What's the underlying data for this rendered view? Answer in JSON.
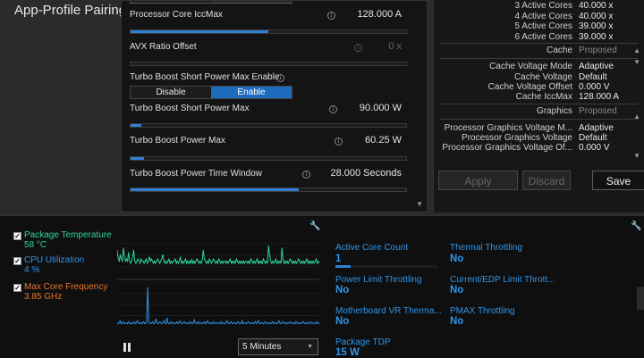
{
  "app": {
    "section_title": "App-Profile Pairing"
  },
  "tuning": {
    "partial_toggle": {
      "left": "Disable",
      "right": "Enable"
    },
    "rows": [
      {
        "label": "Processor Core IccMax",
        "value": "128.000 A",
        "level": 0.5
      },
      {
        "label": "AVX Ratio Offset",
        "value": "0 x",
        "level": 0.0
      },
      {
        "label": "Turbo Boost Short Power Max Enable",
        "toggle": {
          "left": "Disable",
          "right": "Enable",
          "selected": "Enable"
        }
      },
      {
        "label": "Turbo Boost Short Power Max",
        "value": "90.000 W",
        "level": 0.04
      },
      {
        "label": "Turbo Boost Power Max",
        "value": "60.25 W",
        "level": 0.05
      },
      {
        "label": "Turbo Boost Power Time Window",
        "value": "28.000 Seconds",
        "level": 0.61
      }
    ]
  },
  "specs": {
    "cores": [
      {
        "k": "3 Active Cores",
        "v": "40.000 x"
      },
      {
        "k": "4 Active Cores",
        "v": "40.000 x"
      },
      {
        "k": "5 Active Cores",
        "v": "39.000 x"
      },
      {
        "k": "6 Active Cores",
        "v": "39.000 x"
      }
    ],
    "cache_header": {
      "k": "Cache",
      "v": "Proposed"
    },
    "cache": [
      {
        "k": "Cache Voltage Mode",
        "v": "Adaptive"
      },
      {
        "k": "Cache Voltage",
        "v": "Default"
      },
      {
        "k": "Cache Voltage Offset",
        "v": "0.000 V"
      },
      {
        "k": "Cache IccMax",
        "v": "128.000 A"
      }
    ],
    "graphics_header": {
      "k": "Graphics",
      "v": "Proposed"
    },
    "graphics": [
      {
        "k": "Processor Graphics Voltage M...",
        "v": "Adaptive"
      },
      {
        "k": "Processor Graphics Voltage",
        "v": "Default"
      },
      {
        "k": "Processor Graphics Voltage Of...",
        "v": "0.000 V"
      }
    ],
    "buttons": {
      "apply": "Apply",
      "discard": "Discard",
      "save": "Save"
    }
  },
  "monitor": {
    "metrics": [
      {
        "label": "Package Temperature",
        "value": "58 °C",
        "color": "#2fd3a0",
        "checked": "✓"
      },
      {
        "label": "CPU Utilization",
        "value": "4 %",
        "color": "#2f94ea",
        "checked": "✓"
      },
      {
        "label": "Max Core Frequency",
        "value": "3.85 GHz",
        "color": "#e8742a",
        "checked": "✓"
      }
    ],
    "interval": "5 Minutes",
    "stats": [
      {
        "label": "Active Core Count",
        "value": "1",
        "level": 0.15
      },
      {
        "label": "Thermal Throttling",
        "value": "No"
      },
      {
        "label": "Power Limit Throttling",
        "value": "No"
      },
      {
        "label": "Current/EDP Limit Thrott...",
        "value": "No"
      },
      {
        "label": "Motherboard VR Therma...",
        "value": "No"
      },
      {
        "label": "PMAX Throttling",
        "value": "No"
      },
      {
        "label": "Package TDP",
        "value": "15 W"
      }
    ]
  },
  "chart_data": {
    "type": "line",
    "series": [
      {
        "name": "Package Temperature",
        "color": "#2fd3a0",
        "values": [
          62,
          58,
          57,
          60,
          58,
          57,
          63,
          59,
          57,
          58,
          57,
          61,
          57,
          56,
          57,
          59,
          62,
          57,
          56,
          57,
          58,
          57,
          56,
          58,
          57,
          57,
          56,
          57,
          58,
          56,
          57,
          59,
          57,
          58,
          57,
          56,
          57,
          56,
          57,
          58,
          57,
          56,
          57,
          58,
          60,
          57,
          56,
          57,
          56,
          57,
          58,
          56,
          57,
          56,
          57,
          57,
          58,
          56,
          57,
          56,
          57,
          59,
          56,
          57,
          56,
          57,
          58,
          56,
          57,
          56,
          57,
          56,
          58,
          56,
          57,
          56,
          57,
          58,
          57,
          56,
          57,
          56,
          57,
          62,
          58,
          57,
          56,
          57,
          56,
          58,
          57,
          56,
          57,
          58,
          57,
          56,
          57,
          56,
          58,
          57,
          56,
          57,
          56,
          57,
          57,
          56,
          57,
          56,
          57,
          58,
          56,
          57,
          56,
          57,
          56,
          58,
          57,
          56,
          57,
          56,
          57,
          56,
          57,
          56,
          57,
          57,
          56,
          57,
          56,
          58,
          57,
          56,
          57,
          56,
          57,
          58,
          56,
          57,
          56,
          57,
          56,
          58,
          57,
          56,
          57,
          56,
          64,
          60,
          57,
          56,
          57,
          56,
          57,
          58,
          56,
          57,
          56,
          57,
          56,
          63,
          58,
          56,
          57,
          56,
          57,
          56,
          57,
          58,
          57,
          56,
          57,
          56,
          57,
          56,
          57,
          58,
          57,
          56,
          57,
          56,
          57,
          56,
          57,
          58,
          56,
          57,
          56,
          57,
          56,
          57,
          56,
          57,
          58,
          56,
          57,
          56
        ]
      },
      {
        "name": "CPU Utilization",
        "color": "#2f94ea",
        "values": [
          4,
          3,
          4,
          6,
          3,
          4,
          5,
          3,
          4,
          4,
          3,
          5,
          4,
          3,
          4,
          3,
          4,
          5,
          3,
          4,
          6,
          4,
          3,
          4,
          3,
          4,
          5,
          3,
          4,
          4,
          40,
          6,
          4,
          3,
          4,
          5,
          3,
          4,
          8,
          4,
          3,
          4,
          5,
          4,
          3,
          4,
          6,
          4,
          3,
          9,
          4,
          3,
          4,
          5,
          3,
          4,
          4,
          3,
          4,
          5,
          3,
          4,
          6,
          4,
          3,
          4,
          5,
          4,
          3,
          4,
          4,
          3,
          5,
          4,
          3,
          4,
          7,
          4,
          3,
          4,
          5,
          3,
          4,
          4,
          3,
          4,
          5,
          3,
          4,
          6,
          4,
          3,
          4,
          4,
          3,
          5,
          4,
          3,
          4,
          4,
          3,
          4,
          5,
          3,
          4,
          4,
          3,
          4,
          6,
          4,
          3,
          4,
          5,
          4,
          3,
          4,
          4,
          3,
          4,
          5,
          4,
          3,
          4,
          6,
          3,
          4,
          4,
          3,
          4,
          5,
          4,
          3,
          4,
          4,
          3,
          4,
          5,
          3,
          4,
          6,
          4,
          3,
          4,
          4,
          3,
          4,
          5,
          4,
          3,
          4,
          4,
          3,
          4,
          5,
          3,
          4,
          4,
          3,
          4,
          6,
          4,
          3,
          4,
          5,
          4,
          3,
          4,
          4,
          3,
          4,
          5,
          4,
          3,
          4,
          4,
          3,
          5,
          4,
          3,
          4,
          4,
          3,
          4,
          5,
          4,
          3,
          4,
          4,
          3,
          4,
          5,
          4,
          3,
          4,
          4,
          3,
          4,
          5,
          3,
          4
        ]
      }
    ]
  }
}
